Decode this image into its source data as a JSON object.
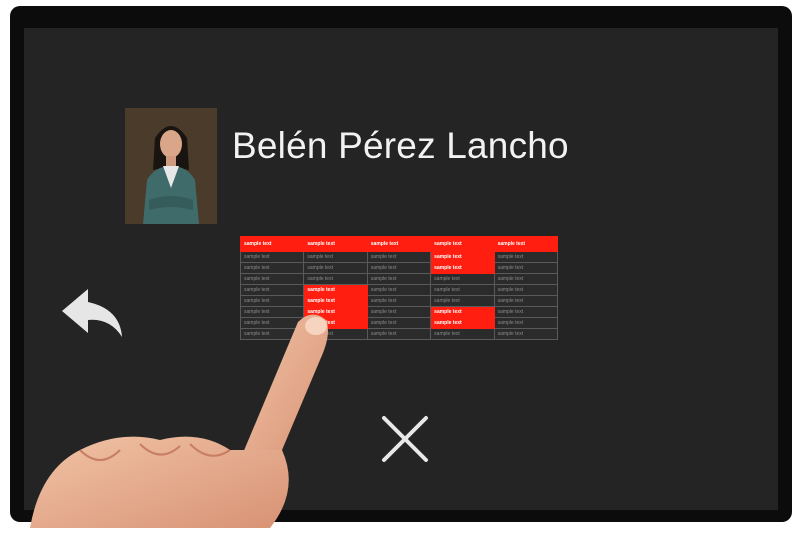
{
  "profile": {
    "name": "Belén Pérez Lancho",
    "avatar_alt": "profile-photo"
  },
  "table": {
    "headers": [
      "sample text",
      "sample text",
      "sample text",
      "sample text",
      "sample text"
    ],
    "rows": [
      [
        "sample text",
        "sample text",
        "sample text",
        "sample text",
        "sample text"
      ],
      [
        "sample text",
        "sample text",
        "sample text",
        "sample text",
        "sample text"
      ],
      [
        "sample text",
        "sample text",
        "sample text",
        "sample text",
        "sample text"
      ],
      [
        "sample text",
        "sample text",
        "sample text",
        "sample text",
        "sample text"
      ],
      [
        "sample text",
        "sample text",
        "sample text",
        "sample text",
        "sample text"
      ],
      [
        "sample text",
        "sample text",
        "sample text",
        "sample text",
        "sample text"
      ],
      [
        "sample text",
        "sample text",
        "sample text",
        "sample text",
        "sample text"
      ],
      [
        "sample text",
        "sample text",
        "sample text",
        "sample text",
        "sample text"
      ]
    ],
    "highlighted_cells": [
      [
        0,
        3
      ],
      [
        1,
        3
      ],
      [
        3,
        1
      ],
      [
        4,
        1
      ],
      [
        5,
        1
      ],
      [
        5,
        3
      ],
      [
        6,
        1
      ],
      [
        6,
        3
      ]
    ]
  },
  "icons": {
    "back": "back-arrow-icon",
    "close": "close-icon"
  },
  "colors": {
    "screen_bg": "#242424",
    "accent_red": "#ff1e10",
    "text_light": "#f2f2f2"
  }
}
